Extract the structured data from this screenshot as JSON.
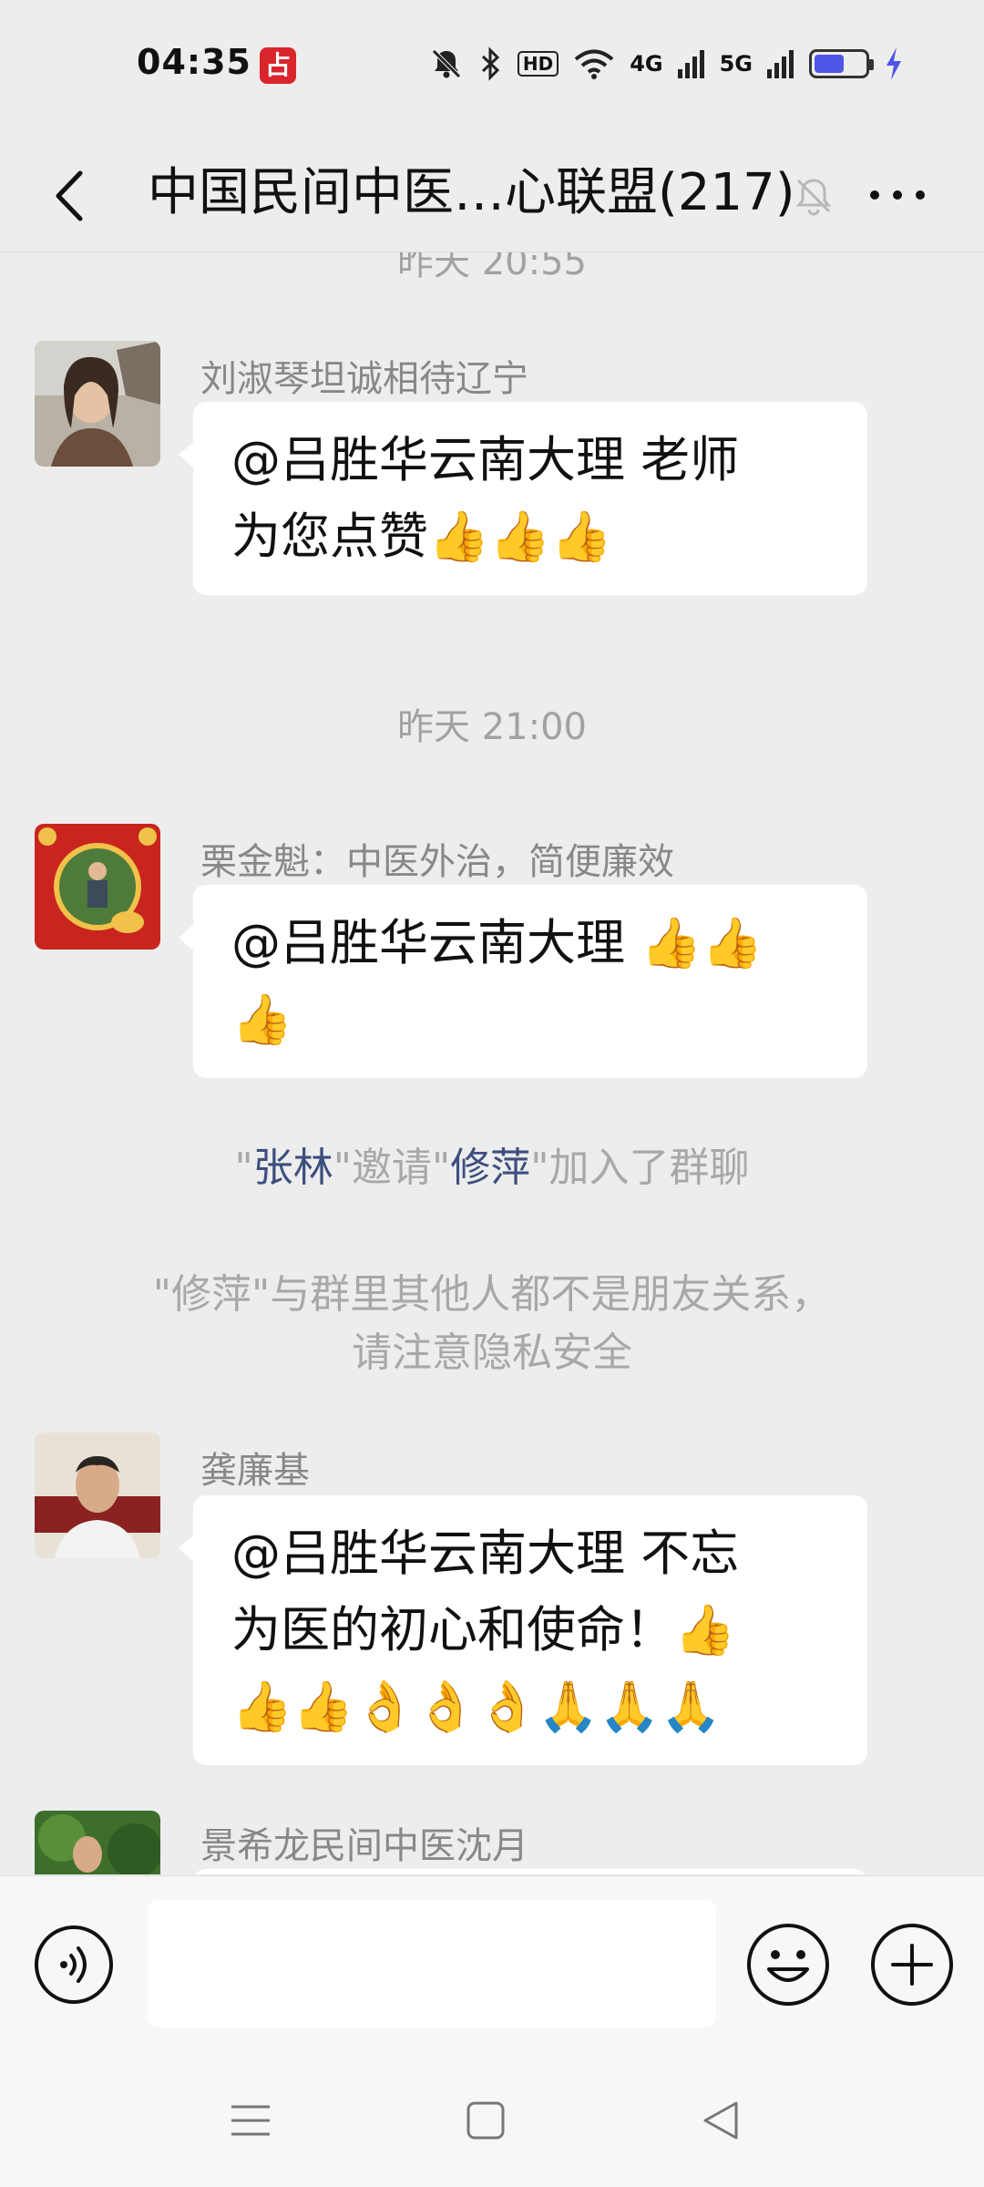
{
  "status_bar": {
    "time": "04:35",
    "app_badge": "占",
    "hd_label": "HD",
    "net1": "4G",
    "net2": "5G",
    "battery_level": 0.6
  },
  "header": {
    "title": "中国民间中医…心联盟(217)"
  },
  "messages": [
    {
      "sender": "刘淑琴坦诚相待辽宁",
      "lines": [
        "@吕胜华云南大理  老师",
        "为您点赞👍👍👍"
      ]
    },
    {
      "sender": "栗金魁：中医外治，简便廉效",
      "lines": [
        "@吕胜华云南大理 👍👍",
        "👍"
      ]
    },
    {
      "sender": "龚廉基",
      "lines": [
        "@吕胜华云南大理  不忘",
        "为医的初心和使命！👍",
        "👍👍👌👌👌🙏🙏🙏"
      ]
    },
    {
      "sender": "景希龙民间中医沈月"
    }
  ],
  "timestamps": {
    "cut": "昨天 20:55",
    "main": "昨天 21:00"
  },
  "system": {
    "invite": {
      "q1": "\"",
      "inviter": "张林",
      "q2": "\"邀请\"",
      "invitee": "修萍",
      "q3": "\"加入了群聊"
    },
    "privacy_line1": "\"修萍\"与群里其他人都不是朋友关系，",
    "privacy_line2": "请注意隐私安全"
  },
  "input": {
    "placeholder": ""
  },
  "colors": {
    "background": "#ededed",
    "bubble": "#ffffff",
    "name_link": "#3d4f7f",
    "badge": "#d9262c",
    "battery": "#4e56e6"
  },
  "icons": [
    "back-arrow-icon",
    "mute-icon",
    "more-icon",
    "voice-icon",
    "emoji-icon",
    "plus-icon",
    "menu-icon",
    "home-icon",
    "back-triangle-icon"
  ]
}
